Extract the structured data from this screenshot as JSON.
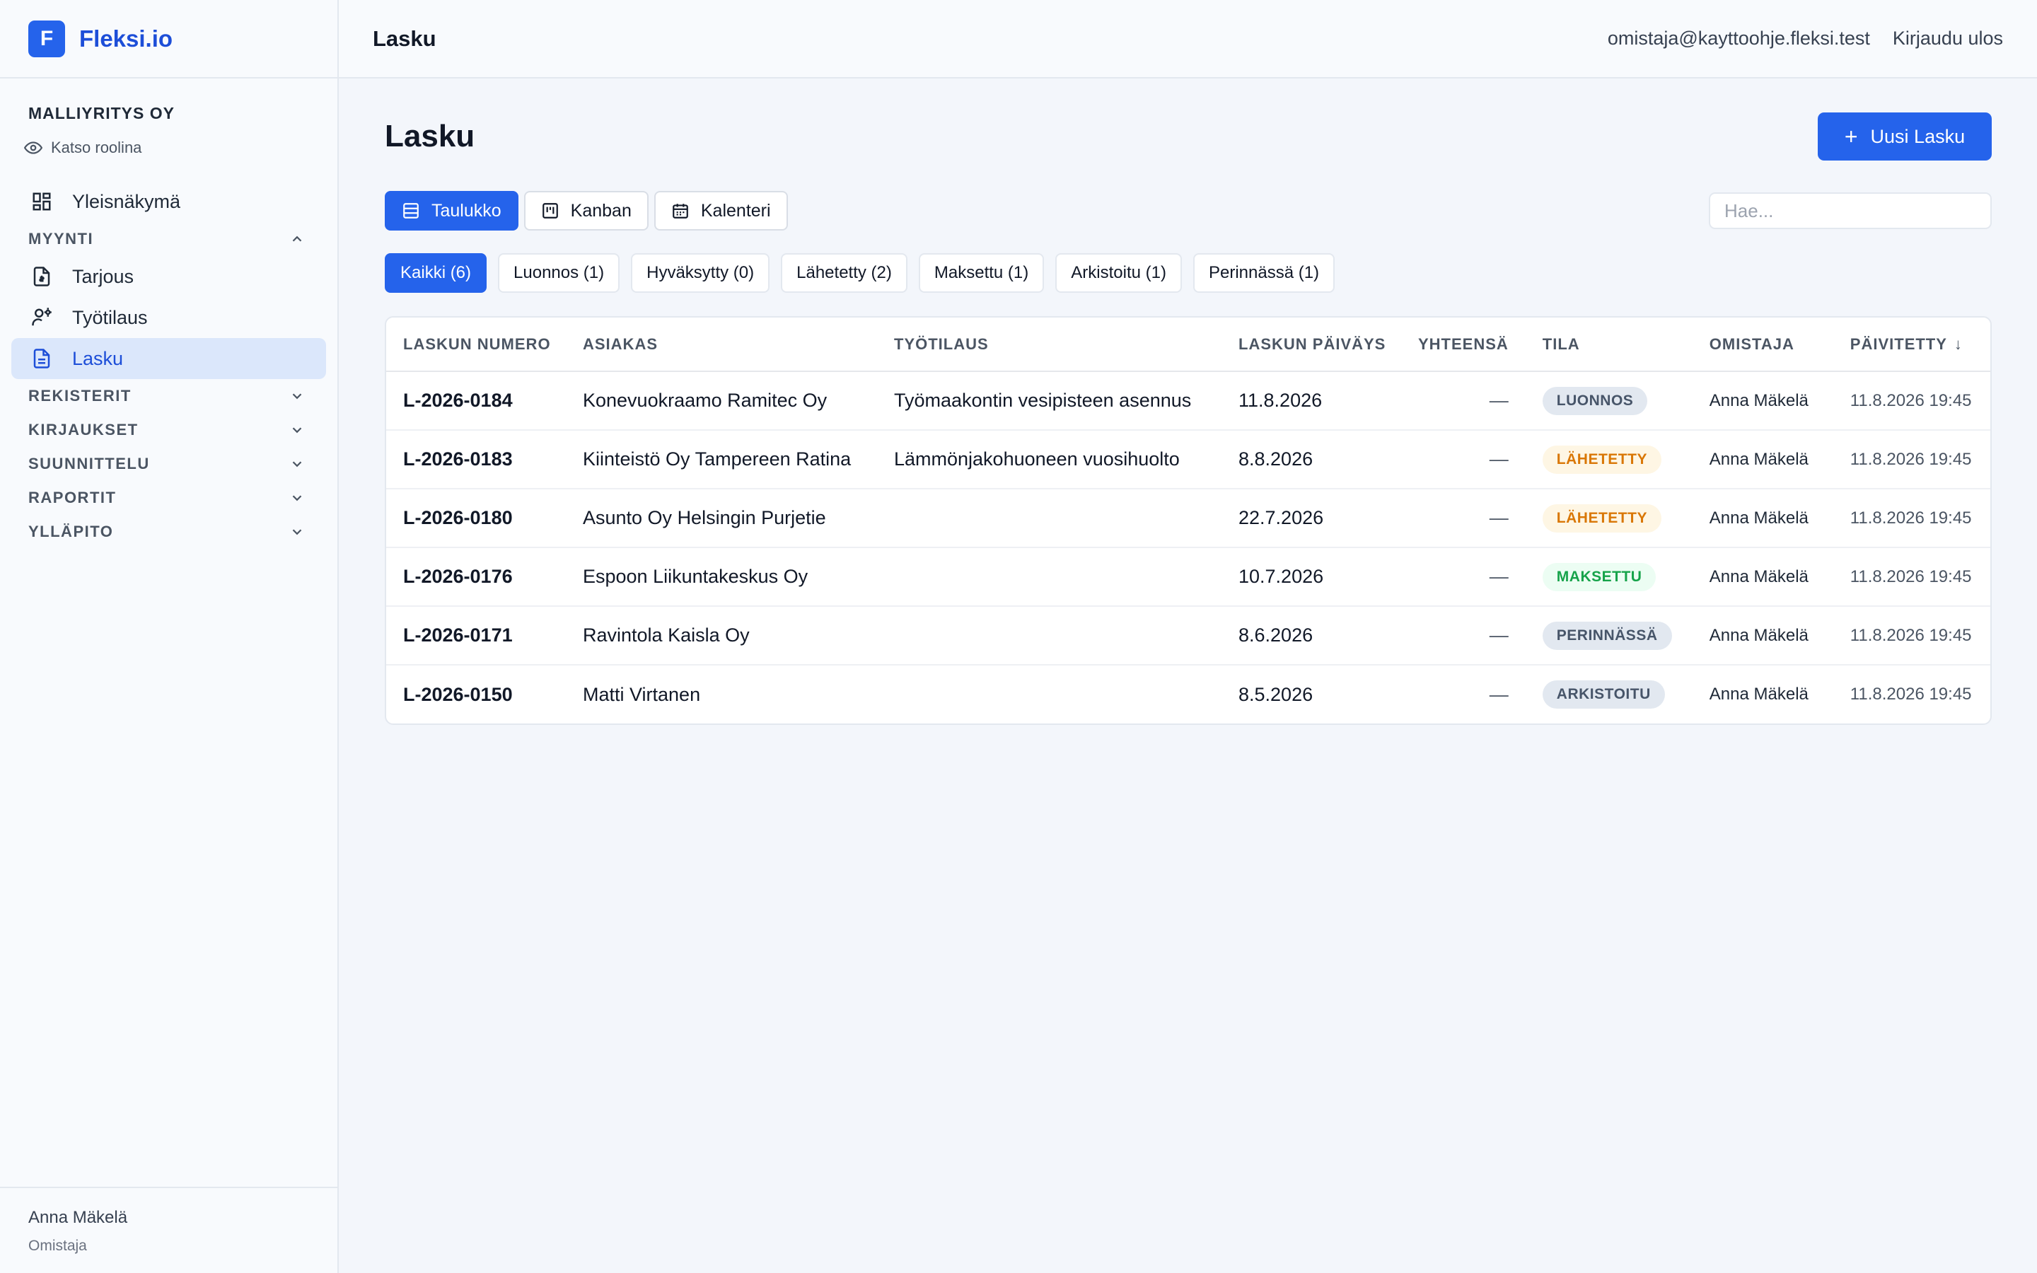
{
  "app": {
    "logo_letter": "F",
    "name": "Fleksi.io"
  },
  "company": {
    "name": "MALLIYRITYS OY",
    "view_role": "Katso roolina"
  },
  "sidebar": {
    "overview": "Yleisnäkymä",
    "sections": {
      "myynti": "MYYNTI",
      "rekisterit": "REKISTERIT",
      "kirjaukset": "KIRJAUKSET",
      "suunnittelu": "SUUNNITTELU",
      "raportit": "RAPORTIT",
      "yllapito": "YLLÄPITO"
    },
    "items": {
      "tarjous": "Tarjous",
      "tyotilaus": "Työtilaus",
      "lasku": "Lasku"
    },
    "footer": {
      "name": "Anna Mäkelä",
      "role": "Omistaja"
    }
  },
  "topbar": {
    "title": "Lasku",
    "email": "omistaja@kayttoohje.fleksi.test",
    "logout": "Kirjaudu ulos"
  },
  "page": {
    "title": "Lasku",
    "new_button": "Uusi Lasku",
    "new_icon": "+"
  },
  "views": {
    "table": "Taulukko",
    "kanban": "Kanban",
    "calendar": "Kalenteri"
  },
  "search": {
    "placeholder": "Hae..."
  },
  "filters": [
    {
      "label": "Kaikki (6)",
      "active": true
    },
    {
      "label": "Luonnos (1)",
      "active": false
    },
    {
      "label": "Hyväksytty (0)",
      "active": false
    },
    {
      "label": "Lähetetty (2)",
      "active": false
    },
    {
      "label": "Maksettu (1)",
      "active": false
    },
    {
      "label": "Arkistoitu (1)",
      "active": false
    },
    {
      "label": "Perinnässä (1)",
      "active": false
    }
  ],
  "table": {
    "columns": {
      "number": "LASKUN NUMERO",
      "customer": "ASIAKAS",
      "work_order": "TYÖTILAUS",
      "date": "LASKUN PÄIVÄYS",
      "total": "YHTEENSÄ",
      "status": "TILA",
      "owner": "OMISTAJA",
      "updated": "PÄIVITETTY",
      "sort_icon": "↓"
    },
    "rows": [
      {
        "number": "L-2026-0184",
        "customer": "Konevuokraamo Ramitec Oy",
        "work_order": "Työmaakontin vesipisteen asennus",
        "date": "11.8.2026",
        "total": "—",
        "status": "LUONNOS",
        "status_bg": "#e2e8f0",
        "status_fg": "#475569",
        "owner": "Anna Mäkelä",
        "updated": "11.8.2026 19:45"
      },
      {
        "number": "L-2026-0183",
        "customer": "Kiinteistö Oy Tampereen Ratina",
        "work_order": "Lämmönjakohuoneen vuosihuolto",
        "date": "8.8.2026",
        "total": "—",
        "status": "LÄHETETTY",
        "status_bg": "#fef6e4",
        "status_fg": "#d97706",
        "owner": "Anna Mäkelä",
        "updated": "11.8.2026 19:45"
      },
      {
        "number": "L-2026-0180",
        "customer": "Asunto Oy Helsingin Purjetie",
        "work_order": "",
        "date": "22.7.2026",
        "total": "—",
        "status": "LÄHETETTY",
        "status_bg": "#fef6e4",
        "status_fg": "#d97706",
        "owner": "Anna Mäkelä",
        "updated": "11.8.2026 19:45"
      },
      {
        "number": "L-2026-0176",
        "customer": "Espoon Liikuntakeskus Oy",
        "work_order": "",
        "date": "10.7.2026",
        "total": "—",
        "status": "MAKSETTU",
        "status_bg": "#ecfdf3",
        "status_fg": "#16a34a",
        "owner": "Anna Mäkelä",
        "updated": "11.8.2026 19:45"
      },
      {
        "number": "L-2026-0171",
        "customer": "Ravintola Kaisla Oy",
        "work_order": "",
        "date": "8.6.2026",
        "total": "—",
        "status": "PERINNÄSSÄ",
        "status_bg": "#e2e8f0",
        "status_fg": "#475569",
        "owner": "Anna Mäkelä",
        "updated": "11.8.2026 19:45"
      },
      {
        "number": "L-2026-0150",
        "customer": "Matti Virtanen",
        "work_order": "",
        "date": "8.5.2026",
        "total": "—",
        "status": "ARKISTOITU",
        "status_bg": "#e2e8f0",
        "status_fg": "#475569",
        "owner": "Anna Mäkelä",
        "updated": "11.8.2026 19:45"
      }
    ]
  },
  "colors": {
    "accent": "#2563eb",
    "accent_light": "#dbe7fb",
    "background": "#f3f6fb"
  }
}
